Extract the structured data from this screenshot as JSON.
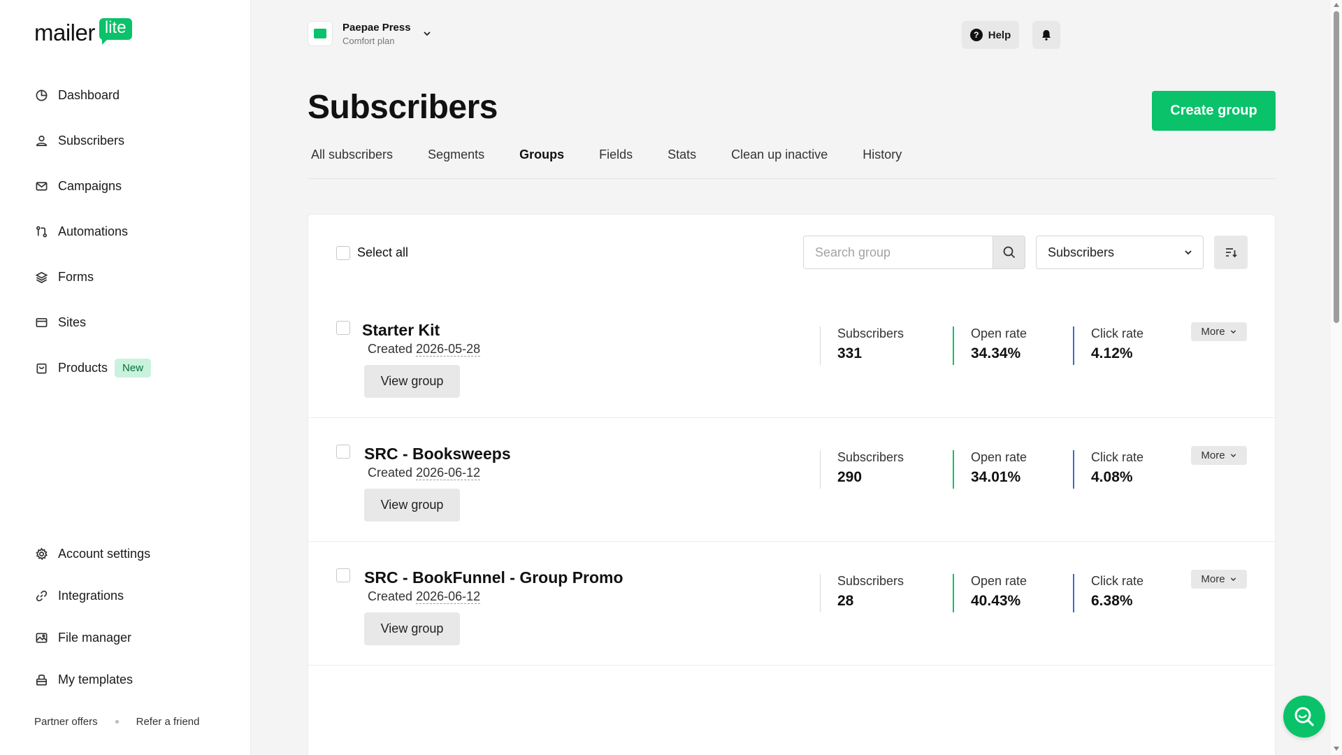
{
  "logo": {
    "text": "mailer",
    "badge": "lite"
  },
  "sidebar": {
    "items": [
      {
        "label": "Dashboard",
        "icon": "clock-icon"
      },
      {
        "label": "Subscribers",
        "icon": "user-icon"
      },
      {
        "label": "Campaigns",
        "icon": "mail-icon"
      },
      {
        "label": "Automations",
        "icon": "automation-icon"
      },
      {
        "label": "Forms",
        "icon": "layers-icon"
      },
      {
        "label": "Sites",
        "icon": "browser-icon"
      },
      {
        "label": "Products",
        "icon": "bag-icon",
        "badge": "New"
      }
    ],
    "bottom_items": [
      {
        "label": "Account settings",
        "icon": "gear-icon"
      },
      {
        "label": "Integrations",
        "icon": "link-icon"
      },
      {
        "label": "File manager",
        "icon": "image-icon"
      },
      {
        "label": "My templates",
        "icon": "template-icon"
      }
    ],
    "footer": {
      "partner": "Partner offers",
      "refer": "Refer a friend"
    }
  },
  "header": {
    "account_name": "Paepae Press",
    "account_plan": "Comfort plan",
    "help_label": "Help"
  },
  "page": {
    "title": "Subscribers",
    "create_label": "Create group",
    "tabs": [
      "All subscribers",
      "Segments",
      "Groups",
      "Fields",
      "Stats",
      "Clean up inactive",
      "History"
    ],
    "active_tab": "Groups"
  },
  "toolbar": {
    "select_all": "Select all",
    "search_placeholder": "Search group",
    "sort_value": "Subscribers"
  },
  "groups": [
    {
      "name": "Starter Kit",
      "created_label": "Created",
      "created_date": "2026-05-28",
      "view_label": "View group",
      "more_label": "More",
      "stats": {
        "subscribers_label": "Subscribers",
        "subscribers": "331",
        "open_label": "Open rate",
        "open": "34.34%",
        "click_label": "Click rate",
        "click": "4.12%"
      }
    },
    {
      "name": "SRC - Booksweeps",
      "created_label": "Created",
      "created_date": "2026-06-12",
      "view_label": "View group",
      "more_label": "More",
      "stats": {
        "subscribers_label": "Subscribers",
        "subscribers": "290",
        "open_label": "Open rate",
        "open": "34.01%",
        "click_label": "Click rate",
        "click": "4.08%"
      }
    },
    {
      "name": "SRC - BookFunnel - Group Promo",
      "created_label": "Created",
      "created_date": "2026-06-12",
      "view_label": "View group",
      "more_label": "More",
      "stats": {
        "subscribers_label": "Subscribers",
        "subscribers": "28",
        "open_label": "Open rate",
        "open": "40.43%",
        "click_label": "Click rate",
        "click": "6.38%"
      }
    }
  ],
  "colors": {
    "brand": "#09c269",
    "open_rate": "#09c269",
    "click_rate": "#2e6fd6"
  }
}
